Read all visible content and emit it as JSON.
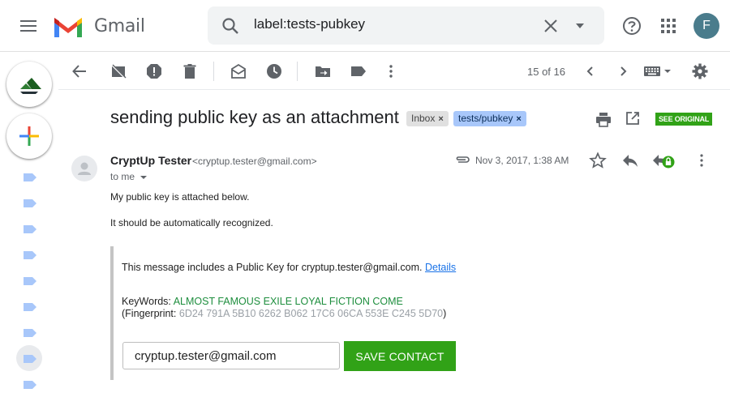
{
  "app": {
    "name": "Gmail",
    "avatar_initial": "F"
  },
  "search": {
    "value": "label:tests-pubkey"
  },
  "toolbar": {
    "page_count": "15 of 16"
  },
  "subject": {
    "text": "sending public key as an attachment",
    "labels": [
      {
        "name": "Inbox",
        "remove": "×"
      },
      {
        "name": "tests/pubkey",
        "remove": "×"
      }
    ],
    "see_original": "SEE ORIGINAL"
  },
  "message": {
    "sender_name": "CryptUp Tester",
    "sender_email": "<cryptup.tester@gmail.com>",
    "to": "to me",
    "date": "Nov 3, 2017, 1:38 AM",
    "body_lines": [
      "My public key is attached below.",
      "It should be automatically recognized."
    ]
  },
  "pubkey": {
    "intro": "This message includes a Public Key for cryptup.tester@gmail.com.",
    "details_link": "Details",
    "keywords_label": "KeyWords:",
    "keywords": "ALMOST FAMOUS EXILE LOYAL FICTION COME",
    "fingerprint_label": "(Fingerprint:",
    "fingerprint": "6D24 791A 5B10 6262 B062 17C6 06CA 553E C245 5D70",
    "fingerprint_close": ")",
    "contact_value": "cryptup.tester@gmail.com",
    "save_button": "SAVE CONTACT"
  },
  "colors": {
    "accent_green": "#31a217",
    "link_blue": "#1a73e8",
    "keyword_green": "#1e8e3e",
    "label_blue": "#a8c7fa"
  },
  "icons": {
    "topbar": [
      "menu-icon",
      "gmail-logo",
      "search-icon",
      "close-icon",
      "dropdown-icon",
      "help-icon",
      "apps-icon"
    ],
    "toolbar": [
      "back-icon",
      "archive-icon",
      "spam-icon",
      "delete-icon",
      "mark-unread-icon",
      "snooze-icon",
      "move-to-icon",
      "label-icon",
      "more-icon",
      "chevron-left-icon",
      "chevron-right-icon",
      "keyboard-icon",
      "gear-icon"
    ]
  }
}
